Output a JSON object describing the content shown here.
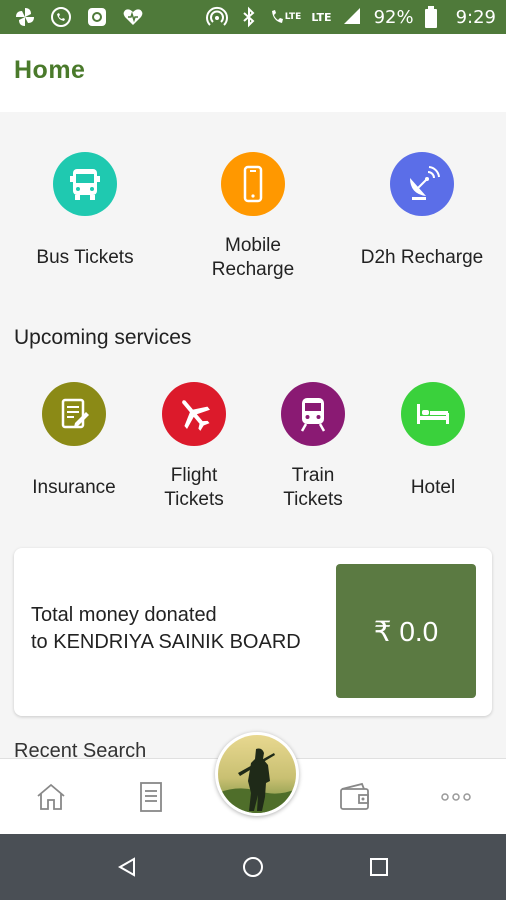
{
  "status_bar": {
    "battery": "92%",
    "time": "9:29",
    "lte1": "LTE",
    "lte2": "LTE",
    "left_icons": [
      "pinwheel-icon",
      "phone-circle-icon",
      "app-icon",
      "heart-icon"
    ],
    "right_icons": [
      "hotspot-icon",
      "bluetooth-icon",
      "volte-call-icon",
      "signal-icon",
      "battery-icon"
    ]
  },
  "header": {
    "title": "Home"
  },
  "services": [
    {
      "label": "Bus Tickets",
      "icon": "bus-icon",
      "color": "#1fc9b0"
    },
    {
      "label": "Mobile\nRecharge",
      "icon": "mobile-icon",
      "color": "#ff9800"
    },
    {
      "label": "D2h Recharge",
      "icon": "satellite-dish-icon",
      "color": "#5b6ee8"
    }
  ],
  "upcoming": {
    "title": "Upcoming services",
    "items": [
      {
        "label": "Insurance",
        "icon": "document-pen-icon",
        "color": "#8b8a16"
      },
      {
        "label": "Flight\nTickets",
        "icon": "airplane-icon",
        "color": "#dc1a2b"
      },
      {
        "label": "Train\nTickets",
        "icon": "train-icon",
        "color": "#8a1a73"
      },
      {
        "label": "Hotel",
        "icon": "bed-icon",
        "color": "#3ad13c"
      }
    ]
  },
  "donation": {
    "line1": "Total money donated",
    "line2": "to KENDRIYA SAINIK BOARD",
    "amount": "₹ 0.0"
  },
  "recent": {
    "title": "Recent Search"
  },
  "bottom_nav": [
    "home-icon",
    "document-icon",
    "soldier-avatar",
    "wallet-icon",
    "more-icon"
  ],
  "colors": {
    "status_bar": "#4f7a3a",
    "title": "#4a7a2b",
    "amount_box": "#5b7a42",
    "system_nav": "#4a4f55"
  }
}
